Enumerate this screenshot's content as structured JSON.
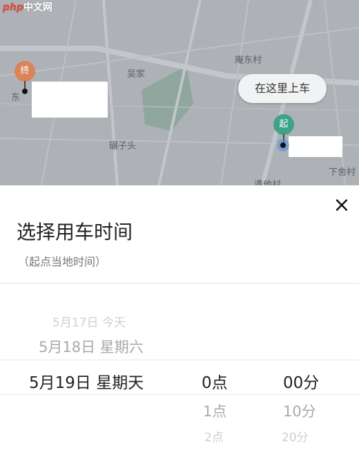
{
  "watermark": {
    "php": "php",
    "text": "中文网"
  },
  "map": {
    "pickup_bubble": "在这里上车",
    "start_marker": "起",
    "end_marker": "终",
    "place_labels": [
      "庵东村",
      "吴家",
      "东",
      "碾子头",
      "下舍村",
      "遇他村"
    ]
  },
  "sheet": {
    "close_icon": "×",
    "title": "选择用车时间",
    "subtitle": "（起点当地时间）",
    "picker": {
      "dates": [
        "5月17日 今天",
        "5月18日 星期六",
        "5月19日 星期天"
      ],
      "hours": [
        "0点",
        "1点",
        "2点"
      ],
      "minutes": [
        "00分",
        "10分",
        "20分"
      ]
    }
  },
  "colors": {
    "start_marker": "#3fa38a",
    "end_marker": "#d9845a",
    "map_bg": "#aeb2b7"
  }
}
